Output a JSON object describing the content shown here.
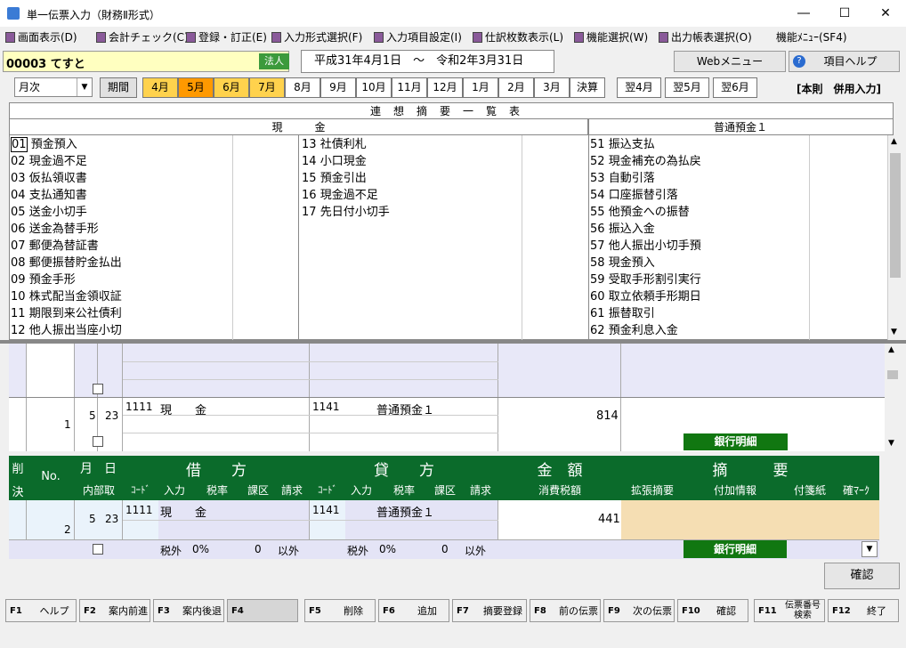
{
  "window": {
    "title": "単一伝票入力（財務Ⅱ形式）",
    "minimize": "―",
    "maximize": "☐",
    "close": "✕"
  },
  "menu": [
    "画面表示(D)",
    "会計チェック(C)",
    "登録・訂正(E)",
    "入力形式選択(F)",
    "入力項目設定(I)",
    "仕訳枚数表示(L)",
    "機能選択(W)",
    "出力帳表選択(O)",
    "機能ﾒﾆｭｰ(SF4)"
  ],
  "company": {
    "code": "00003 てすと",
    "type_badge": "法人"
  },
  "period": {
    "from": "平成31年4月1日",
    "sep": "～",
    "to": "令和2年3月31日"
  },
  "top_buttons": {
    "web_menu": "Webメニュー",
    "help": "項目ヘルプ"
  },
  "period_select": {
    "value": "月次",
    "label": "期間"
  },
  "months": [
    "4月",
    "5月",
    "6月",
    "7月",
    "8月",
    "9月",
    "10月",
    "11月",
    "12月",
    "1月",
    "2月",
    "3月",
    "決算",
    "翌4月",
    "翌5月",
    "翌6月"
  ],
  "mode_label": "[本則　併用入力]",
  "renso": {
    "title": "連想摘要一覧表",
    "col1_title": "現　　　金",
    "col2_title": "普通預金１",
    "col1a": [
      [
        "01",
        "預金預入"
      ],
      [
        "02",
        "現金過不足"
      ],
      [
        "03",
        "仮払領収書"
      ],
      [
        "04",
        "支払通知書"
      ],
      [
        "05",
        "送金小切手"
      ],
      [
        "06",
        "送金為替手形"
      ],
      [
        "07",
        "郵便為替証書"
      ],
      [
        "08",
        "郵便振替貯金払出"
      ],
      [
        "09",
        "預金手形"
      ],
      [
        "10",
        "株式配当金領収証"
      ],
      [
        "11",
        "期限到来公社債利"
      ],
      [
        "12",
        "他人振出当座小切"
      ]
    ],
    "col1b": [
      [
        "13",
        "社債利札"
      ],
      [
        "14",
        "小口現金"
      ],
      [
        "15",
        "預金引出"
      ],
      [
        "16",
        "現金過不足"
      ],
      [
        "17",
        "先日付小切手"
      ]
    ],
    "col2": [
      [
        "51",
        "振込支払"
      ],
      [
        "52",
        "現金補充の為払戻"
      ],
      [
        "53",
        "自動引落"
      ],
      [
        "54",
        "口座振替引落"
      ],
      [
        "55",
        "他預金への振替"
      ],
      [
        "56",
        "振込入金"
      ],
      [
        "57",
        "他人振出小切手預"
      ],
      [
        "58",
        "現金預入"
      ],
      [
        "59",
        "受取手形割引実行"
      ],
      [
        "60",
        "取立依頼手形期日"
      ],
      [
        "61",
        "振替取引"
      ],
      [
        "62",
        "預金利息入金"
      ]
    ]
  },
  "entry1": {
    "no": "1",
    "month": "5",
    "day": "23",
    "debit_code": "1111",
    "debit_name": "現　　金",
    "credit_code": "1141",
    "credit_name": "普通預金１",
    "amount": "814",
    "bank_button": "銀行明細"
  },
  "grid_header": {
    "del": "削",
    "ketsu": "決",
    "no": "No.",
    "month": "月",
    "day": "日",
    "naibu": "内部取",
    "debit": "借　　方",
    "credit": "貸　　方",
    "amount": "金　額",
    "summary": "摘　　　要",
    "code": "ｺｰﾄﾞ",
    "input": "入力",
    "rate": "税率",
    "kaku": "課区",
    "seikyu": "請求",
    "tax": "消費税額",
    "ext": "拡張摘要",
    "addinfo": "付加情報",
    "fusen": "付箋紙",
    "mark": "確ﾏｰｸ"
  },
  "entry2": {
    "no": "2",
    "month": "5",
    "day": "23",
    "debit_code": "1111",
    "debit_name": "現　　金",
    "credit_code": "1141",
    "credit_name": "普通預金１",
    "amount": "441",
    "debit_tax": "税外",
    "debit_rate": "0%",
    "debit_kaku": "0",
    "debit_seikyu": "以外",
    "credit_tax": "税外",
    "credit_rate": "0%",
    "credit_kaku": "0",
    "credit_seikyu": "以外",
    "bank_button": "銀行明細"
  },
  "confirm_button": "確認",
  "fkeys": [
    {
      "key": "F1",
      "label": "ヘルプ"
    },
    {
      "key": "F2",
      "label": "案内前進"
    },
    {
      "key": "F3",
      "label": "案内後退"
    },
    {
      "key": "F4",
      "label": ""
    },
    {
      "key": "F5",
      "label": "削除"
    },
    {
      "key": "F6",
      "label": "追加"
    },
    {
      "key": "F7",
      "label": "摘要登録"
    },
    {
      "key": "F8",
      "label": "前の伝票"
    },
    {
      "key": "F9",
      "label": "次の伝票"
    },
    {
      "key": "F10",
      "label": "確認"
    },
    {
      "key": "F11",
      "label": "伝票番号検索"
    },
    {
      "key": "F12",
      "label": "終了"
    }
  ]
}
